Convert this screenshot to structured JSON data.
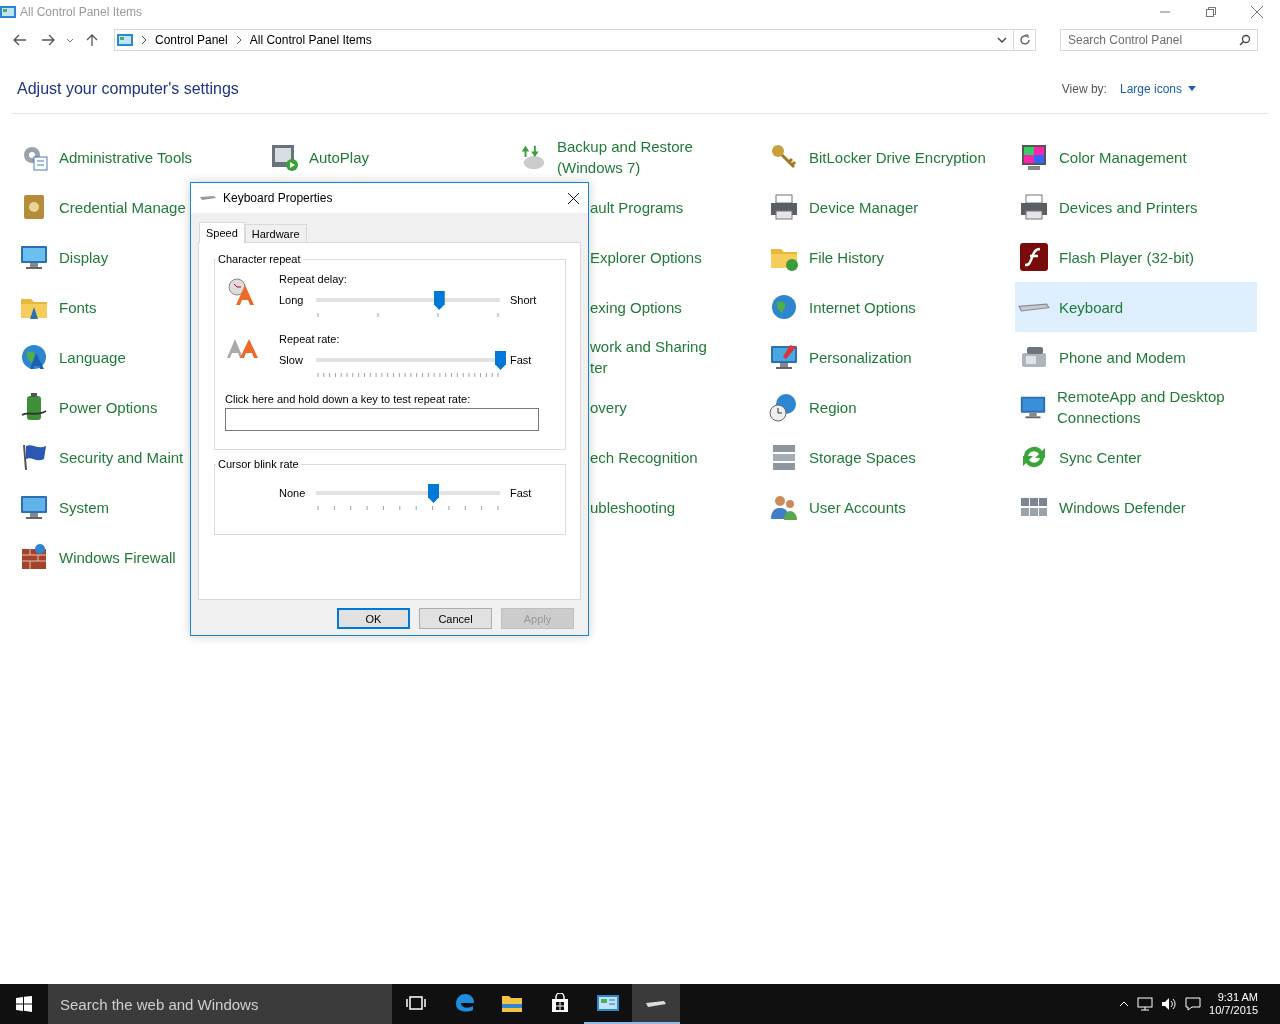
{
  "window": {
    "title": "All Control Panel Items"
  },
  "address": {
    "crumbs": [
      "Control Panel",
      "All Control Panel Items"
    ],
    "search_placeholder": "Search Control Panel"
  },
  "header": {
    "heading": "Adjust your computer's settings",
    "view_by_label": "View by:",
    "view_by_value": "Large icons"
  },
  "columns": [
    [
      {
        "label": "Administrative Tools",
        "kind": "full",
        "selected": false
      },
      {
        "label": "Credential Manage",
        "kind": "full",
        "selected": false
      },
      {
        "label": "Display",
        "kind": "full",
        "selected": false
      },
      {
        "label": "Fonts",
        "kind": "full",
        "selected": false
      },
      {
        "label": "Language",
        "kind": "full",
        "selected": false
      },
      {
        "label": "Power Options",
        "kind": "full",
        "selected": false
      },
      {
        "label": "Security and Maint",
        "kind": "full",
        "selected": false
      },
      {
        "label": "System",
        "kind": "full",
        "selected": false
      },
      {
        "label": "Windows Firewall",
        "kind": "full",
        "selected": false
      }
    ],
    [
      {
        "label": "AutoPlay",
        "kind": "full",
        "selected": false
      }
    ],
    [
      {
        "label": "Backup and Restore (Windows 7)",
        "kind": "full",
        "selected": false
      },
      {
        "label": "ault Programs",
        "kind": "cut",
        "selected": false
      },
      {
        "label": "Explorer Options",
        "kind": "cut",
        "selected": false
      },
      {
        "label": "exing Options",
        "kind": "cut",
        "selected": false
      },
      {
        "label": "work and Sharing\nter",
        "kind": "cut",
        "selected": false
      },
      {
        "label": "overy",
        "kind": "cut",
        "selected": false
      },
      {
        "label": "ech Recognition",
        "kind": "cut",
        "selected": false
      },
      {
        "label": "ubleshooting",
        "kind": "cut",
        "selected": false
      }
    ],
    [
      {
        "label": "BitLocker Drive Encryption",
        "kind": "full",
        "selected": false
      },
      {
        "label": "Device Manager",
        "kind": "full",
        "selected": false
      },
      {
        "label": "File History",
        "kind": "full",
        "selected": false
      },
      {
        "label": "Internet Options",
        "kind": "full",
        "selected": false
      },
      {
        "label": "Personalization",
        "kind": "full",
        "selected": false
      },
      {
        "label": "Region",
        "kind": "full",
        "selected": false
      },
      {
        "label": "Storage Spaces",
        "kind": "full",
        "selected": false
      },
      {
        "label": "User Accounts",
        "kind": "full",
        "selected": false
      }
    ],
    [
      {
        "label": "Color Management",
        "kind": "full",
        "selected": false
      },
      {
        "label": "Devices and Printers",
        "kind": "full",
        "selected": false
      },
      {
        "label": "Flash Player (32-bit)",
        "kind": "full",
        "selected": false
      },
      {
        "label": "Keyboard",
        "kind": "full",
        "selected": true
      },
      {
        "label": "Phone and Modem",
        "kind": "full",
        "selected": false
      },
      {
        "label": "RemoteApp and Desktop Connections",
        "kind": "full",
        "selected": false
      },
      {
        "label": "Sync Center",
        "kind": "full",
        "selected": false
      },
      {
        "label": "Windows Defender",
        "kind": "full",
        "selected": false
      }
    ]
  ],
  "dialog": {
    "title": "Keyboard Properties",
    "tabs": [
      {
        "label": "Speed",
        "selected": true
      },
      {
        "label": "Hardware",
        "selected": false
      }
    ],
    "character_repeat": {
      "legend": "Character repeat",
      "delay": {
        "label": "Repeat delay:",
        "min_label": "Long",
        "max_label": "Short",
        "level": 0.667
      },
      "rate": {
        "label": "Repeat rate:",
        "min_label": "Slow",
        "max_label": "Fast",
        "level": 1.0
      },
      "test_label": "Click here and hold down a key to test repeat rate:"
    },
    "cursor_blink": {
      "legend": "Cursor blink rate",
      "min_label": "None",
      "max_label": "Fast",
      "level": 0.636
    },
    "buttons": [
      {
        "label": "OK",
        "default": true,
        "disabled": false
      },
      {
        "label": "Cancel",
        "default": false,
        "disabled": false
      },
      {
        "label": "Apply",
        "default": false,
        "disabled": true
      }
    ]
  },
  "taskbar": {
    "search_placeholder": "Search the web and Windows",
    "apps": [
      {
        "open": false,
        "selected": false
      },
      {
        "open": false,
        "selected": false
      },
      {
        "open": false,
        "selected": false
      },
      {
        "open": false,
        "selected": false
      },
      {
        "open": true,
        "selected": false
      },
      {
        "open": true,
        "selected": true
      }
    ],
    "time": "9:31 AM",
    "date": "10/7/2015"
  }
}
